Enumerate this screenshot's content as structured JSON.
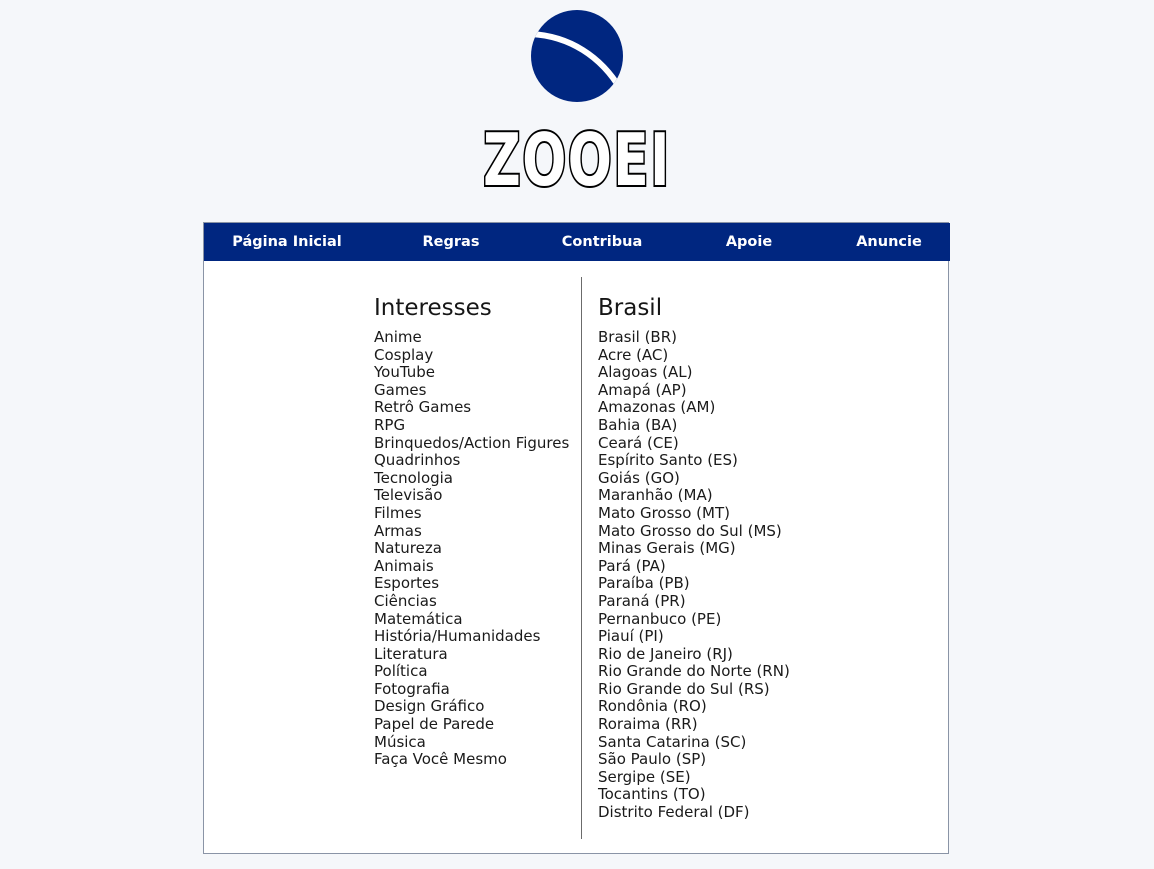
{
  "brand": {
    "name": "ZOOEI",
    "colors": {
      "primary": "#002680",
      "page_background": "#f5f7fa"
    },
    "logo_icon": "blue-circle-swoosh"
  },
  "nav": {
    "items": [
      {
        "label": "Página Inicial"
      },
      {
        "label": "Regras"
      },
      {
        "label": "Contribua"
      },
      {
        "label": "Apoie"
      },
      {
        "label": "Anuncie"
      }
    ]
  },
  "interesses": {
    "title": "Interesses",
    "items": [
      "Anime",
      "Cosplay",
      "YouTube",
      "Games",
      "Retrô Games",
      "RPG",
      "Brinquedos/Action Figures",
      "Quadrinhos",
      "Tecnologia",
      "Televisão",
      "Filmes",
      "Armas",
      "Natureza",
      "Animais",
      "Esportes",
      "Ciências",
      "Matemática",
      "História/Humanidades",
      "Literatura",
      "Política",
      "Fotografia",
      "Design Gráfico",
      "Papel de Parede",
      "Música",
      "Faça Você Mesmo"
    ]
  },
  "brasil": {
    "title": "Brasil",
    "items": [
      "Brasil (BR)",
      "Acre (AC)",
      "Alagoas (AL)",
      "Amapá (AP)",
      "Amazonas (AM)",
      "Bahia (BA)",
      "Ceará (CE)",
      "Espírito Santo (ES)",
      "Goiás (GO)",
      "Maranhão (MA)",
      "Mato Grosso (MT)",
      "Mato Grosso do Sul (MS)",
      "Minas Gerais (MG)",
      "Pará (PA)",
      "Paraíba (PB)",
      "Paraná (PR)",
      "Pernanbuco (PE)",
      "Piauí (PI)",
      "Rio de Janeiro (RJ)",
      "Rio Grande do Norte (RN)",
      "Rio Grande do Sul (RS)",
      "Rondônia (RO)",
      "Roraima (RR)",
      "Santa Catarina (SC)",
      "São Paulo (SP)",
      "Sergipe (SE)",
      "Tocantins (TO)",
      "Distrito Federal (DF)"
    ]
  }
}
